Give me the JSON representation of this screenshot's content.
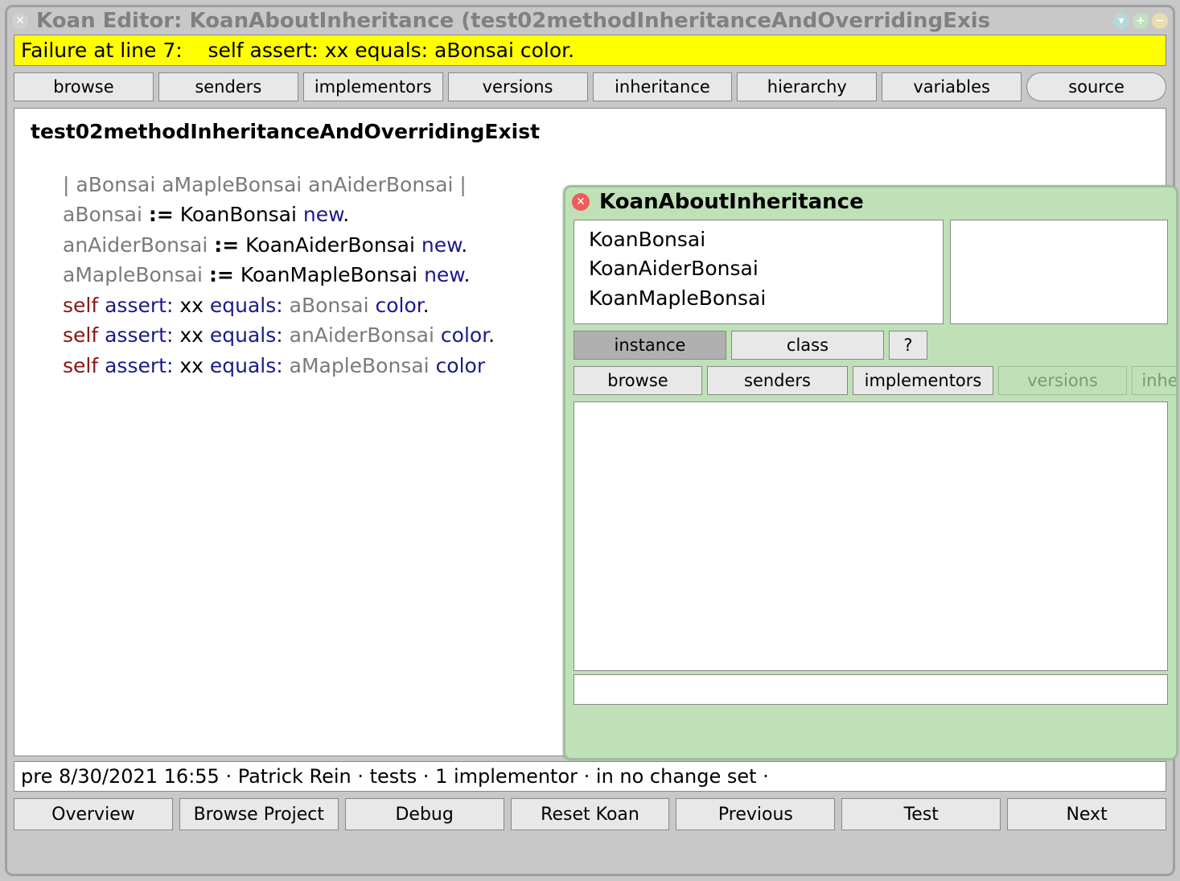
{
  "window": {
    "title": "Koan Editor: KoanAboutInheritance (test02methodInheritanceAndOverridingExis"
  },
  "failure_banner": "Failure at line 7:    self assert: xx equals: aBonsai color.",
  "toolbar": {
    "browse": "browse",
    "senders": "senders",
    "implementors": "implementors",
    "versions": "versions",
    "inheritance": "inheritance",
    "hierarchy": "hierarchy",
    "variables": "variables",
    "source": "source"
  },
  "code": {
    "method_name": "test02methodInheritanceAndOverridingExist",
    "line1_vars": "| aBonsai aMapleBonsai anAiderBonsai |",
    "l2_v": "aBonsai ",
    "l2_a": ":=",
    "l2_c": " KoanBonsai ",
    "l2_k": "new",
    "l2_p": ".",
    "l3_v": "anAiderBonsai ",
    "l3_a": ":=",
    "l3_c": " KoanAiderBonsai ",
    "l3_k": "new",
    "l3_p": ".",
    "l4_v": "aMapleBonsai ",
    "l4_a": ":=",
    "l4_c": " KoanMapleBonsai ",
    "l4_k": "new",
    "l4_p": ".",
    "l5_self": "self ",
    "l5_assert": "assert:",
    "l5_xx": " xx ",
    "l5_eq": "equals:",
    "l5_sp": " ",
    "l5_var": "aBonsai ",
    "l5_col": "color",
    "l5_p": ".",
    "l6_self": "self ",
    "l6_assert": "assert:",
    "l6_xx": " xx ",
    "l6_eq": "equals:",
    "l6_sp": " ",
    "l6_var": "anAiderBonsai ",
    "l6_col": "color",
    "l6_p": ".",
    "l7_self": "self ",
    "l7_assert": "assert:",
    "l7_xx": " xx ",
    "l7_eq": "equals:",
    "l7_sp": " ",
    "l7_var": "aMapleBonsai ",
    "l7_col": "color"
  },
  "popup": {
    "title": "KoanAboutInheritance",
    "classes": [
      "KoanBonsai",
      "KoanAiderBonsai",
      "KoanMapleBonsai"
    ],
    "tabs": {
      "instance": "instance",
      "class": "class",
      "q": "?"
    },
    "toolbar": {
      "browse": "browse",
      "senders": "senders",
      "implementors": "implementors",
      "versions": "versions",
      "inheritance": "inhe"
    }
  },
  "status": "pre 8/30/2021 16:55 · Patrick Rein · tests · 1 implementor · in no change set ·",
  "bottom": {
    "overview": "Overview",
    "browse_project": "Browse Project",
    "debug": "Debug",
    "reset": "Reset Koan",
    "previous": "Previous",
    "test": "Test",
    "next": "Next"
  }
}
